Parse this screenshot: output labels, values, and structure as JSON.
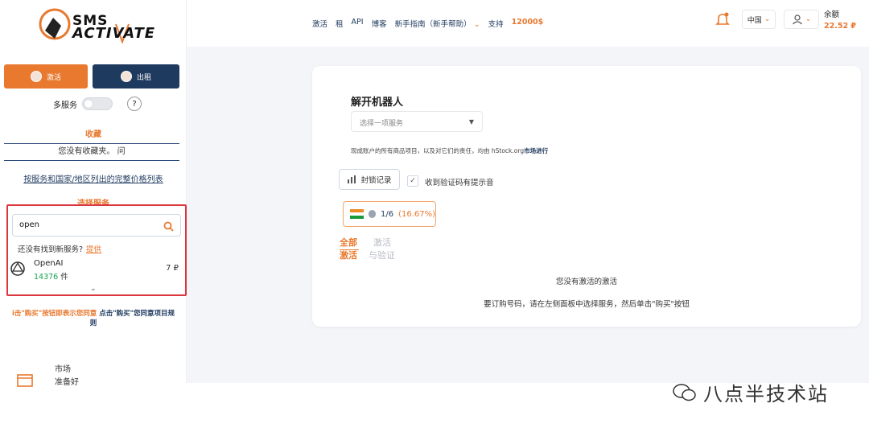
{
  "sidebar": {
    "logo": {
      "line1": "SMS",
      "line2": "ACTIVATE"
    },
    "activate_label": "激活",
    "rent_label": "出租",
    "multi_service_label": "多服务",
    "help_label": "?",
    "favorites_title": "收藏",
    "favorites_empty": "您没有收藏夹。 问",
    "price_list_link": "按服务和国家/地区列出的完整价格列表",
    "choose_service_title": "选择服务",
    "search": {
      "value": "open"
    },
    "not_found_text": "还没有找到新服务?",
    "provide_link": "提供",
    "service": {
      "name": "OpenAI",
      "count": "14376",
      "count_unit": "件",
      "price": "7 ₽"
    },
    "terms_line1_orange": "i击\"购买\"按钮即表示您同意",
    "terms_line1_blue": "点击\"购买\"您同意项目规",
    "terms_line2": "则",
    "market_line1": "市场",
    "market_line2": "准备好"
  },
  "topbar": {
    "nav": [
      "激活",
      "租",
      "API",
      "博客",
      "新手指南（新手帮助）",
      "支持"
    ],
    "money": "12000$",
    "country": "中国",
    "balance_label": "余额",
    "balance_amount": "22.52 ₽"
  },
  "main": {
    "title": "解开机器人",
    "select_placeholder": "选择一项服务",
    "disclaimer": "现成账户的所有商品项目，以及对它们的责任，均由 hStock.org",
    "disclaimer_link": "市场进行",
    "lock_button": "封锁记录",
    "sound_label": "收到验证码有提示音",
    "check_mark": "✓",
    "country_fraction": "1/6",
    "country_percent": "(16.67%)",
    "tab_all": "全部\n激活",
    "tab_all_l1": "全部",
    "tab_all_l2": "激活",
    "tab_act_l1": "激活",
    "tab_act_l2": "与验证",
    "no_activations": "您没有激活的激活",
    "hint": "要订购号码，请在左侧面板中选择服务，然后单击\"购买\"按钮"
  },
  "watermark": "八点半技术站",
  "colors": {
    "accent": "#e8792f",
    "navy": "#1f3a5f",
    "highlight": "#d9363e"
  }
}
